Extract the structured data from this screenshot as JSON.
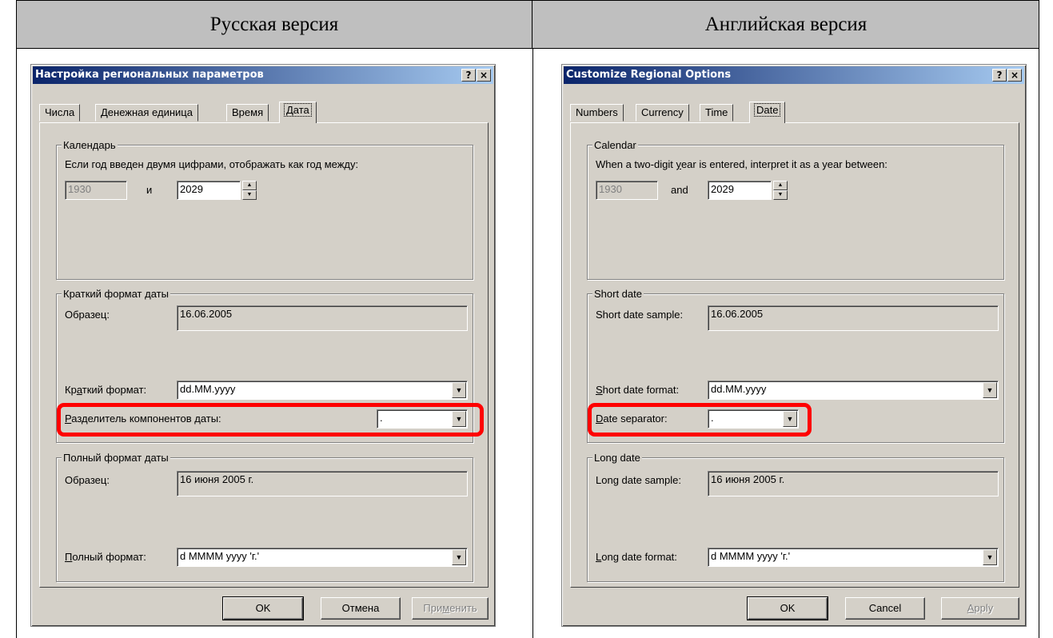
{
  "header": {
    "left": "Русская версия",
    "right": "Английская версия"
  },
  "ru": {
    "title": "Настройка региональных параметров",
    "help_btn": "?",
    "close_btn": "×",
    "tabs": [
      "Числа",
      "Денежная единица",
      "Время",
      "Дата"
    ],
    "calendar": {
      "title": "Календарь",
      "text": "Если год введен двумя цифрами, отображать как год между:",
      "from": "1930",
      "and": "и",
      "to": "2029"
    },
    "short": {
      "title": "Краткий формат даты",
      "sample_label": "Образец:",
      "sample_value": "16.06.2005",
      "format_label_a": "Кр",
      "format_label_u": "а",
      "format_label_b": "ткий формат:",
      "format_value": "dd.MM.yyyy",
      "sep_label_u": "Р",
      "sep_label_b": "азделитель компонентов даты:",
      "sep_value": "."
    },
    "long": {
      "title": "Полный формат даты",
      "sample_label": "Образец:",
      "sample_value": "16 июня 2005 г.",
      "format_label_u": "П",
      "format_label_b": "олный формат:",
      "format_value": "d MMMM yyyy 'г.'"
    },
    "buttons": {
      "ok": "OK",
      "cancel": "Отмена",
      "apply_a": "При",
      "apply_u": "м",
      "apply_b": "енить"
    }
  },
  "en": {
    "title": "Customize Regional Options",
    "help_btn": "?",
    "close_btn": "×",
    "tabs": [
      "Numbers",
      "Currency",
      "Time",
      "Date"
    ],
    "calendar": {
      "title": "Calendar",
      "text_a": "When a two-digit ",
      "text_u": "y",
      "text_b": "ear is entered, interpret it as a year between:",
      "from": "1930",
      "and": "and",
      "to": "2029"
    },
    "short": {
      "title": "Short date",
      "sample_label": "Short date sample:",
      "sample_value": "16.06.2005",
      "format_label_u": "S",
      "format_label_b": "hort date format:",
      "format_value": "dd.MM.yyyy",
      "sep_label_u": "D",
      "sep_label_b": "ate separator:",
      "sep_value": "."
    },
    "long": {
      "title": "Long date",
      "sample_label": "Long date sample:",
      "sample_value": "16 июня 2005 г.",
      "format_label_u": "L",
      "format_label_b": "ong date format:",
      "format_value": "d MMMM yyyy 'г.'"
    },
    "buttons": {
      "ok": "OK",
      "cancel": "Cancel",
      "apply_u": "A",
      "apply_b": "pply"
    }
  },
  "colors": {
    "titlebar_start": "#0a246a",
    "titlebar_end": "#a6caf0",
    "dialog_face": "#d4d0c8",
    "highlight": "#ff0000",
    "header_bg": "#bfbfbf"
  },
  "icons": {
    "spin_up": "▲",
    "spin_down": "▼",
    "dropdown": "▼"
  }
}
